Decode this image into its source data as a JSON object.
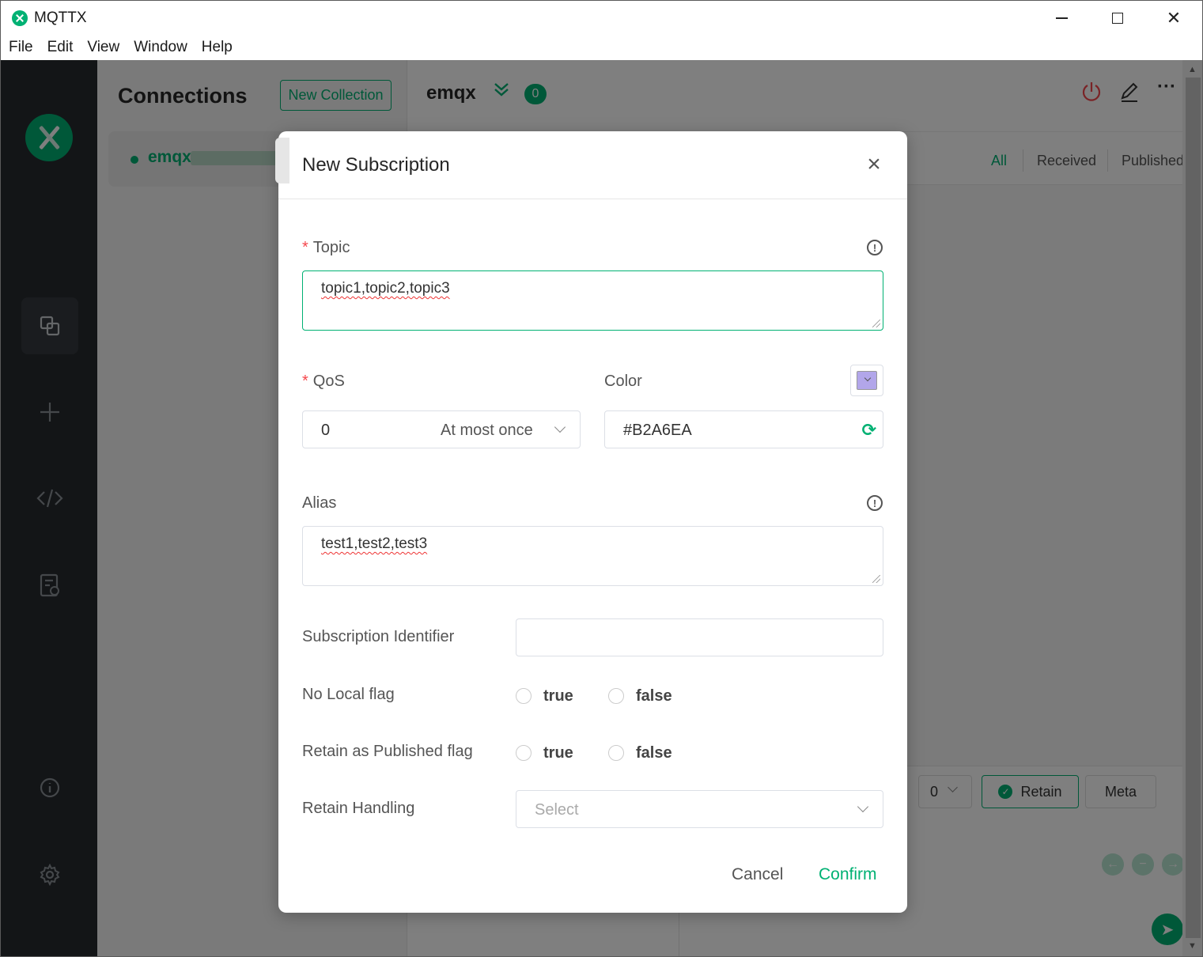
{
  "window": {
    "title": "MQTTX"
  },
  "menu": [
    "File",
    "Edit",
    "View",
    "Window",
    "Help"
  ],
  "connections": {
    "title": "Connections",
    "new_collection_label": "New Collection",
    "items": [
      {
        "name": "emqx",
        "status_color": "#00b173"
      }
    ]
  },
  "main": {
    "title": "emqx",
    "unread_count": "0",
    "filters": [
      "All",
      "Received",
      "Published"
    ],
    "compose": {
      "qos_value": "0",
      "retain_label": "Retain",
      "meta_label": "Meta"
    }
  },
  "dialog": {
    "title": "New Subscription",
    "topic": {
      "label": "Topic",
      "required_mark": "*",
      "value": "topic1,topic2,topic3"
    },
    "qos": {
      "label": "QoS",
      "required_mark": "*",
      "value": "0",
      "description": "At most once"
    },
    "color": {
      "label": "Color",
      "value": "#B2A6EA"
    },
    "alias": {
      "label": "Alias",
      "value": "test1,test2,test3"
    },
    "subscription_identifier": {
      "label": "Subscription Identifier",
      "value": ""
    },
    "no_local_flag": {
      "label": "No Local flag",
      "options": [
        "true",
        "false"
      ]
    },
    "retain_as_published_flag": {
      "label": "Retain as Published flag",
      "options": [
        "true",
        "false"
      ]
    },
    "retain_handling": {
      "label": "Retain Handling",
      "placeholder": "Select"
    },
    "cancel_label": "Cancel",
    "confirm_label": "Confirm"
  },
  "colors": {
    "accent": "#00b173",
    "required": "#f5474c",
    "swatch": "#B2A6EA"
  }
}
